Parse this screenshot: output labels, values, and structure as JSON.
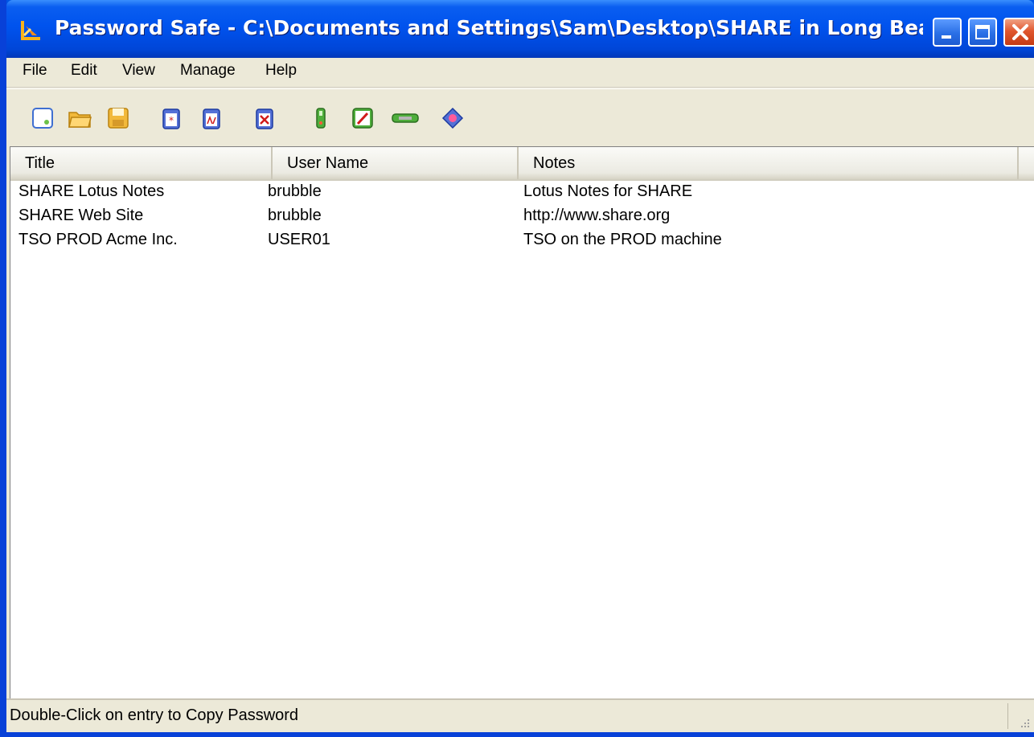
{
  "window": {
    "title": "Password Safe - C:\\Documents and Settings\\Sam\\Desktop\\SHARE in Long Beach\\..."
  },
  "menu": {
    "items": [
      "File",
      "Edit",
      "View",
      "Manage",
      "Help"
    ]
  },
  "toolbar": {
    "icons": [
      "new-database-icon",
      "open-database-icon",
      "save-database-icon",
      "copy-password-icon",
      "copy-username-icon",
      "clear-clipboard-icon",
      "add-entry-icon",
      "edit-entry-icon",
      "delete-entry-icon",
      "help-icon"
    ]
  },
  "list": {
    "columns": [
      "Title",
      "User Name",
      "Notes"
    ],
    "rows": [
      {
        "title": "SHARE Lotus Notes",
        "user": "brubble",
        "notes": "Lotus Notes for SHARE"
      },
      {
        "title": "SHARE Web Site",
        "user": "brubble",
        "notes": "http://www.share.org"
      },
      {
        "title": "TSO PROD Acme Inc.",
        "user": "USER01",
        "notes": "TSO on the PROD machine"
      }
    ]
  },
  "status": {
    "text": "Double-Click on entry to Copy Password"
  },
  "colors": {
    "titlebar": "#0053ee",
    "face": "#ece9d8",
    "close": "#e0572f"
  }
}
